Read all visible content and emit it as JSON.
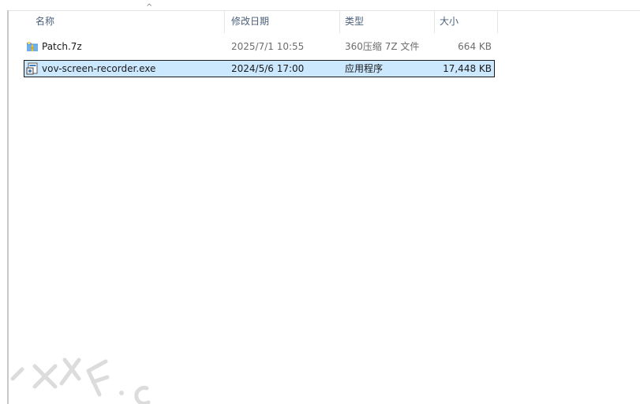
{
  "columns": {
    "name": "名称",
    "modified": "修改日期",
    "type": "类型",
    "size": "大小"
  },
  "sort": {
    "column": "name",
    "direction": "ascending",
    "indicator": "^"
  },
  "files": [
    {
      "name": "Patch.7z",
      "modified": "2025/7/1 10:55",
      "type": "360压缩 7Z 文件",
      "size": "664 KB",
      "icon": "archive-7z-icon",
      "selected": false
    },
    {
      "name": "vov-screen-recorder.exe",
      "modified": "2024/5/6 17:00",
      "type": "应用程序",
      "size": "17,448 KB",
      "icon": "exe-installer-icon",
      "selected": true
    }
  ],
  "colors": {
    "header_text": "#4c607a",
    "selection_bg": "#cce8ff",
    "selection_border": "#1a1a1a",
    "secondary_text": "#6d6d6d"
  }
}
